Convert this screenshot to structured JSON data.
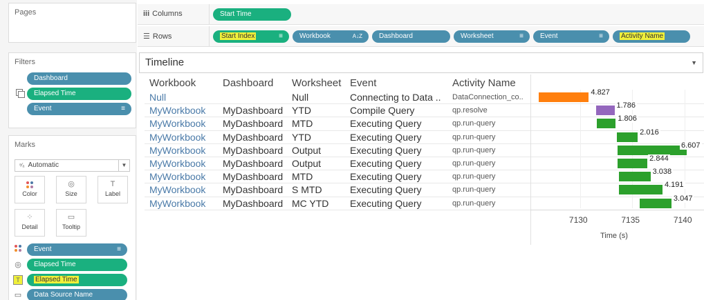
{
  "left_panel": {
    "pages": {
      "title": "Pages"
    },
    "filters": {
      "title": "Filters",
      "pills": [
        {
          "label": "Dashboard",
          "color": "#4a8fad"
        },
        {
          "label": "Elapsed Time",
          "color": "#1ab07f"
        },
        {
          "label": "Event",
          "color": "#4a8fad",
          "sort_icon": "≡"
        }
      ]
    },
    "marks": {
      "title": "Marks",
      "mark_type": "Automatic",
      "buttons": [
        "Color",
        "Size",
        "Label",
        "Detail",
        "Tooltip"
      ],
      "pills": [
        {
          "label": "Event",
          "color": "#4a8fad",
          "icon": "color-dots-icon",
          "sort_icon": "≡"
        },
        {
          "label": "Elapsed Time",
          "color": "#1ab07f",
          "icon": "size-icon"
        },
        {
          "label": "Elapsed Time",
          "color": "#1ab07f",
          "icon": "label-icon",
          "highlighted": true
        },
        {
          "label": "Data Source Name",
          "color": "#4a8fad",
          "icon": "tooltip-icon"
        }
      ]
    }
  },
  "shelves": {
    "columns": {
      "label": "Columns",
      "pills": [
        {
          "label": "Start Time",
          "color": "#1ab07f"
        }
      ]
    },
    "rows": {
      "label": "Rows",
      "pills": [
        {
          "label": "Start Index",
          "color": "#1ab07f",
          "sort_icon": "≡",
          "highlighted": true
        },
        {
          "label": "Workbook",
          "color": "#4a8fad",
          "sort_icon": "A↓Z"
        },
        {
          "label": "Dashboard",
          "color": "#4a8fad"
        },
        {
          "label": "Worksheet",
          "color": "#4a8fad",
          "sort_icon": "≡"
        },
        {
          "label": "Event",
          "color": "#4a8fad",
          "sort_icon": "≡"
        },
        {
          "label": "Activity Name",
          "color": "#4a8fad",
          "highlighted": true
        }
      ]
    }
  },
  "viz": {
    "title": "Timeline",
    "headers": [
      "Workbook",
      "Dashboard",
      "Worksheet",
      "Event",
      "Activity Name"
    ],
    "rows": [
      [
        "Null",
        "",
        "Null",
        "Connecting to Data ..",
        "DataConnection_co.."
      ],
      [
        "MyWorkbook",
        "MyDashboard",
        "YTD",
        "Compile Query",
        "qp.resolve"
      ],
      [
        "MyWorkbook",
        "MyDashboard",
        "MTD",
        "Executing Query",
        "qp.run-query"
      ],
      [
        "MyWorkbook",
        "MyDashboard",
        "YTD",
        "Executing Query",
        "qp.run-query"
      ],
      [
        "MyWorkbook",
        "MyDashboard",
        "Output",
        "Executing Query",
        "qp.run-query"
      ],
      [
        "MyWorkbook",
        "MyDashboard",
        "Output",
        "Executing Query",
        "qp.run-query"
      ],
      [
        "MyWorkbook",
        "MyDashboard",
        "MTD",
        "Executing Query",
        "qp.run-query"
      ],
      [
        "MyWorkbook",
        "MyDashboard",
        "S MTD",
        "Executing Query",
        "qp.run-query"
      ],
      [
        "MyWorkbook",
        "MyDashboard",
        "MC YTD",
        "Executing Query",
        "qp.run-query"
      ]
    ]
  },
  "chart_data": {
    "type": "bar",
    "subtype": "gantt",
    "xlabel": "Time (s)",
    "xlim": [
      7125.5,
      7141.8
    ],
    "x_ticks": [
      7130,
      7135,
      7140
    ],
    "grid": true,
    "series": [
      {
        "start": 7126.0,
        "duration": 4.827,
        "label": "4.827",
        "color": "#ff7f0e"
      },
      {
        "start": 7131.5,
        "duration": 1.786,
        "label": "1.786",
        "color": "#9467bd"
      },
      {
        "start": 7131.6,
        "duration": 1.806,
        "label": "1.806",
        "color": "#2ca02c"
      },
      {
        "start": 7133.5,
        "duration": 2.016,
        "label": "2.016",
        "color": "#2ca02c"
      },
      {
        "start": 7133.6,
        "duration": 6.607,
        "label": "6.607",
        "color": "#2ca02c"
      },
      {
        "start": 7133.6,
        "duration": 2.844,
        "label": "2.844",
        "color": "#2ca02c"
      },
      {
        "start": 7133.7,
        "duration": 3.038,
        "label": "3.038",
        "color": "#2ca02c"
      },
      {
        "start": 7133.7,
        "duration": 4.191,
        "label": "4.191",
        "color": "#2ca02c"
      },
      {
        "start": 7135.7,
        "duration": 3.047,
        "label": "3.047",
        "color": "#2ca02c"
      }
    ]
  }
}
